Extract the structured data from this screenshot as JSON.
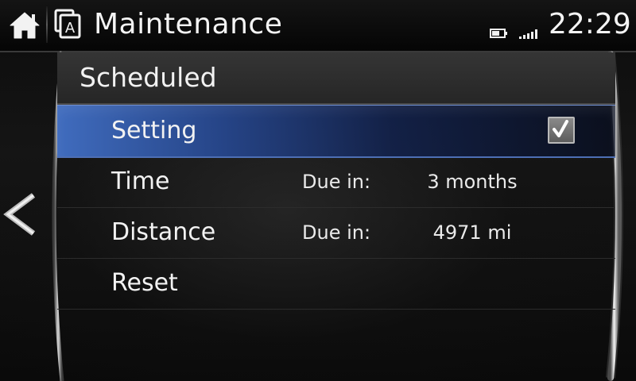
{
  "header": {
    "title": "Maintenance",
    "clock": "22:29",
    "icons": {
      "home": "home-icon",
      "app": "app-switch-icon",
      "app_letter": "A",
      "battery": "battery-icon",
      "signal": "signal-strength-icon"
    }
  },
  "navigation": {
    "back_icon": "chevron-left-icon"
  },
  "list": {
    "section_title": "Scheduled",
    "rows": [
      {
        "label": "Setting",
        "checked": true,
        "selected": true
      },
      {
        "label": "Time",
        "sub_label": "Due in:",
        "value": "3 months"
      },
      {
        "label": "Distance",
        "sub_label": "Due in:",
        "value": "4971 mi"
      },
      {
        "label": "Reset"
      }
    ]
  },
  "colors": {
    "selection_highlight": "#406cbe",
    "header_bg": "#0a0a0a",
    "text": "#f2f2f2"
  }
}
